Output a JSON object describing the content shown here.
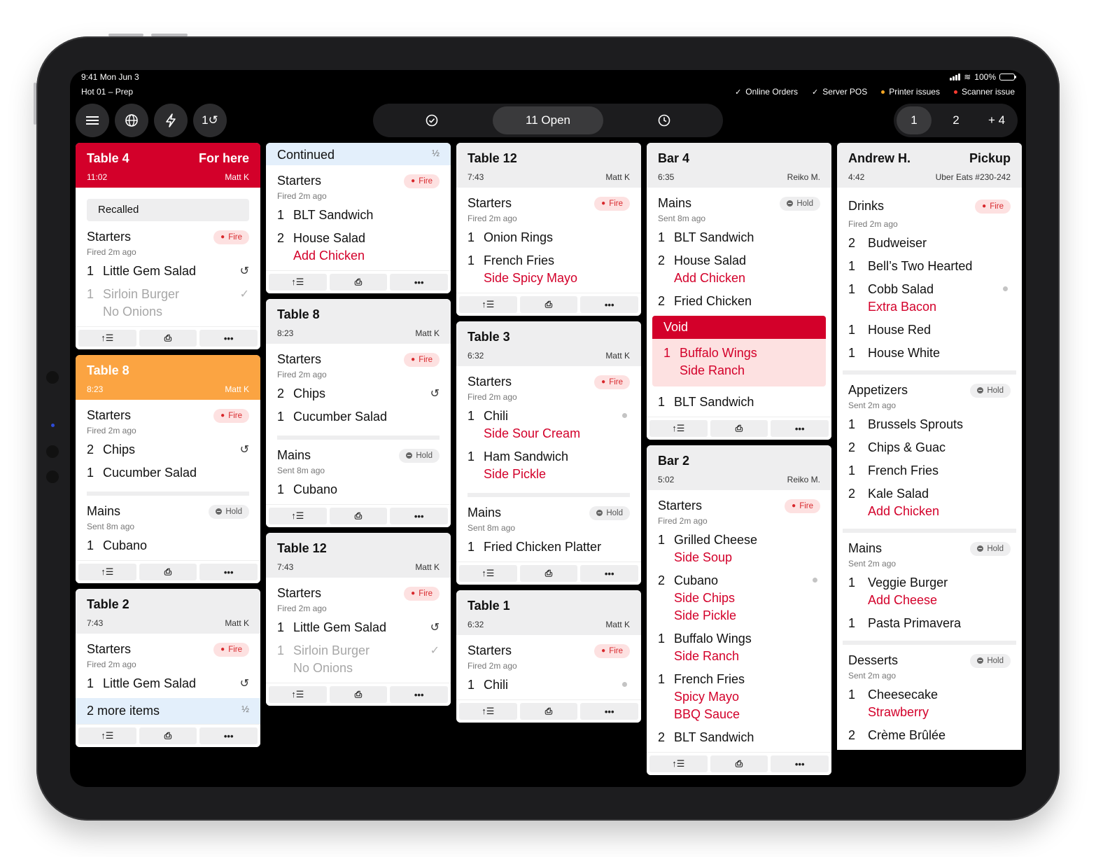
{
  "status": {
    "time": "9:41  Mon Jun 3",
    "station": "Hot 01 – Prep",
    "battery": "100%",
    "sources": [
      {
        "label": "Online Orders",
        "state": "ok",
        "color": "#ffffff"
      },
      {
        "label": "Server POS",
        "state": "ok",
        "color": "#ffffff"
      },
      {
        "label": "Printer issues",
        "state": "warn",
        "color": "#f5a623"
      },
      {
        "label": "Scanner issue",
        "state": "error",
        "color": "#ff3b30"
      }
    ]
  },
  "toolbar": {
    "menu_icon": "menu-icon",
    "globe_icon": "globe-icon",
    "bolt_icon": "bolt-icon",
    "recall_label": "1↺",
    "open_label": "11 Open",
    "pages": [
      "1",
      "2",
      "+ 4"
    ],
    "active_page": "1"
  },
  "colors": {
    "accent_red": "#d3002a",
    "warn_orange": "#fba442",
    "fire_bg": "#fde1e1",
    "continued_bg": "#e3effb"
  },
  "tickets": {
    "t4": {
      "name": "Table 4",
      "mode": "For here",
      "time": "11:02",
      "server": "Matt K",
      "recalled": "Recalled",
      "course": {
        "title": "Starters",
        "status": "Fire",
        "sub": "Fired 2m ago"
      },
      "items": [
        {
          "qty": "1",
          "name": "Little Gem Salad"
        },
        {
          "qty": "1",
          "name": "Sirloin Burger",
          "mod": "No Onions"
        }
      ]
    },
    "t8a": {
      "name": "Table 8",
      "time": "8:23",
      "server": "Matt K",
      "c1": {
        "title": "Starters",
        "status": "Fire",
        "sub": "Fired 2m ago"
      },
      "c1_items": [
        {
          "qty": "2",
          "name": "Chips"
        },
        {
          "qty": "1",
          "name": "Cucumber Salad"
        }
      ],
      "c2": {
        "title": "Mains",
        "status": "Hold",
        "sub": "Sent 8m ago"
      },
      "c2_items": [
        {
          "qty": "1",
          "name": "Cubano"
        }
      ]
    },
    "t2": {
      "name": "Table 2",
      "time": "7:43",
      "server": "Matt K",
      "course": {
        "title": "Starters",
        "status": "Fire",
        "sub": "Fired 2m ago"
      },
      "items": [
        {
          "qty": "1",
          "name": "Little Gem Salad"
        }
      ],
      "more": "2 more items",
      "frac": "½"
    },
    "cont": {
      "name": "Continued",
      "frac": "½",
      "course": {
        "title": "Starters",
        "status": "Fire",
        "sub": "Fired 2m ago"
      },
      "items": [
        {
          "qty": "1",
          "name": "BLT Sandwich"
        },
        {
          "qty": "2",
          "name": "House Salad",
          "mod": "Add Chicken"
        }
      ]
    },
    "t8b": {
      "name": "Table 8",
      "time": "8:23",
      "server": "Matt K",
      "c1": {
        "title": "Starters",
        "status": "Fire",
        "sub": "Fired 2m ago"
      },
      "c1_items": [
        {
          "qty": "2",
          "name": "Chips"
        },
        {
          "qty": "1",
          "name": "Cucumber Salad"
        }
      ],
      "c2": {
        "title": "Mains",
        "status": "Hold",
        "sub": "Sent 8m ago"
      },
      "c2_items": [
        {
          "qty": "1",
          "name": "Cubano"
        }
      ]
    },
    "t12b": {
      "name": "Table 12",
      "time": "7:43",
      "server": "Matt K",
      "course": {
        "title": "Starters",
        "status": "Fire",
        "sub": "Fired 2m ago"
      },
      "items": [
        {
          "qty": "1",
          "name": "Little Gem Salad"
        },
        {
          "qty": "1",
          "name": "Sirloin Burger",
          "mod": "No Onions"
        }
      ]
    },
    "t12a": {
      "name": "Table 12",
      "time": "7:43",
      "server": "Matt K",
      "course": {
        "title": "Starters",
        "status": "Fire",
        "sub": "Fired 2m ago"
      },
      "items": [
        {
          "qty": "1",
          "name": "Onion Rings"
        },
        {
          "qty": "1",
          "name": "French Fries",
          "mod": "Side Spicy Mayo"
        }
      ]
    },
    "t3": {
      "name": "Table 3",
      "time": "6:32",
      "server": "Matt K",
      "c1": {
        "title": "Starters",
        "status": "Fire",
        "sub": "Fired 2m ago"
      },
      "c1_items": [
        {
          "qty": "1",
          "name": "Chili",
          "mod": "Side Sour Cream"
        },
        {
          "qty": "1",
          "name": "Ham Sandwich",
          "mod": "Side Pickle"
        }
      ],
      "c2": {
        "title": "Mains",
        "status": "Hold",
        "sub": "Sent 8m ago"
      },
      "c2_items": [
        {
          "qty": "1",
          "name": "Fried Chicken Platter"
        }
      ]
    },
    "t1": {
      "name": "Table 1",
      "time": "6:32",
      "server": "Matt K",
      "course": {
        "title": "Starters",
        "status": "Fire",
        "sub": "Fired 2m ago"
      },
      "items": [
        {
          "qty": "1",
          "name": "Chili"
        }
      ]
    },
    "bar4": {
      "name": "Bar 4",
      "time": "6:35",
      "server": "Reiko M.",
      "course": {
        "title": "Mains",
        "status": "Hold",
        "sub": "Sent 8m ago"
      },
      "items": [
        {
          "qty": "1",
          "name": "BLT Sandwich"
        },
        {
          "qty": "2",
          "name": "House Salad",
          "mod": "Add Chicken"
        },
        {
          "qty": "2",
          "name": "Fried Chicken"
        }
      ],
      "void_label": "Void",
      "void_item": {
        "qty": "1",
        "name": "Buffalo Wings",
        "mod": "Side Ranch"
      },
      "after_void": {
        "qty": "1",
        "name": "BLT Sandwich"
      }
    },
    "bar2": {
      "name": "Bar 2",
      "time": "5:02",
      "server": "Reiko M.",
      "course": {
        "title": "Starters",
        "status": "Fire",
        "sub": "Fired 2m ago"
      },
      "items": [
        {
          "qty": "1",
          "name": "Grilled Cheese",
          "mods": [
            "Side Soup"
          ]
        },
        {
          "qty": "2",
          "name": "Cubano",
          "mods": [
            "Side Chips",
            "Side Pickle"
          ]
        },
        {
          "qty": "1",
          "name": "Buffalo Wings",
          "mods": [
            "Side Ranch"
          ]
        },
        {
          "qty": "1",
          "name": "French Fries",
          "mods": [
            "Spicy Mayo",
            "BBQ Sauce"
          ]
        },
        {
          "qty": "2",
          "name": "BLT Sandwich",
          "mods": []
        }
      ]
    },
    "andrew": {
      "name": "Andrew H.",
      "mode": "Pickup",
      "time": "4:42",
      "source": "Uber Eats #230-242",
      "drinks": {
        "title": "Drinks",
        "status": "Fire",
        "sub": "Fired 2m ago"
      },
      "drink_items": [
        {
          "qty": "2",
          "name": "Budweiser"
        },
        {
          "qty": "1",
          "name": "Bell’s Two Hearted"
        },
        {
          "qty": "1",
          "name": "Cobb Salad",
          "mod": "Extra Bacon"
        },
        {
          "qty": "1",
          "name": "House Red"
        },
        {
          "qty": "1",
          "name": "House White"
        }
      ],
      "apps": {
        "title": "Appetizers",
        "status": "Hold",
        "sub": "Sent 2m ago"
      },
      "app_items": [
        {
          "qty": "1",
          "name": "Brussels Sprouts"
        },
        {
          "qty": "2",
          "name": "Chips & Guac"
        },
        {
          "qty": "1",
          "name": "French Fries"
        },
        {
          "qty": "2",
          "name": "Kale Salad",
          "mod": "Add Chicken"
        }
      ],
      "mains": {
        "title": "Mains",
        "status": "Hold",
        "sub": "Sent 2m ago"
      },
      "main_items": [
        {
          "qty": "1",
          "name": "Veggie Burger",
          "mod": "Add Cheese"
        },
        {
          "qty": "1",
          "name": "Pasta Primavera"
        }
      ],
      "desserts": {
        "title": "Desserts",
        "status": "Hold",
        "sub": "Sent 2m ago"
      },
      "dessert_items": [
        {
          "qty": "1",
          "name": "Cheesecake",
          "mod": "Strawberry"
        },
        {
          "qty": "2",
          "name": "Crème Brûlée"
        }
      ]
    }
  },
  "footer": {
    "bump_icon": "bump-icon",
    "print_icon": "printer-icon",
    "more_icon": "more-icon"
  }
}
